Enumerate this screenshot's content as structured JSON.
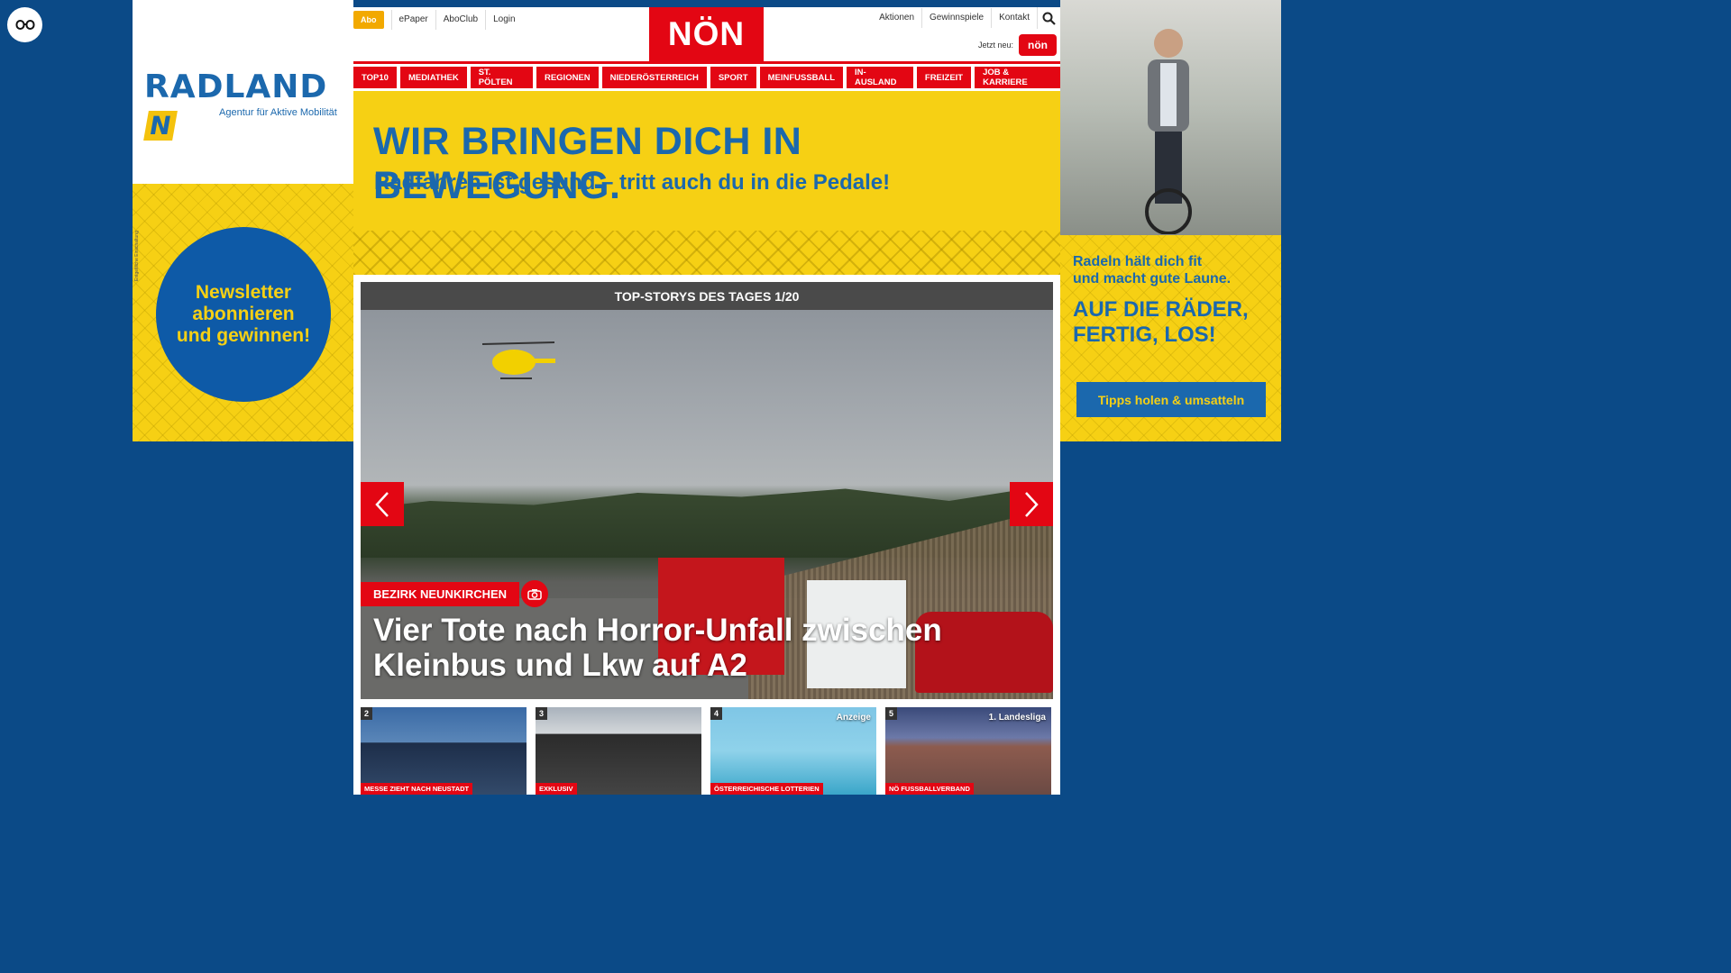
{
  "accessibility": {
    "icon": "glasses-icon"
  },
  "ad_left": {
    "brand": "RADLAND",
    "brand_badge": "N",
    "tagline": "Agentur für Aktive Mobilität",
    "newsletter_line1": "Newsletter",
    "newsletter_line2": "abonnieren",
    "newsletter_line3": "und gewinnen!",
    "small_print": "Entgeltliche Einschaltung"
  },
  "header": {
    "util_left": {
      "abo": "Abo",
      "epaper": "ePaper",
      "aboclub": "AboClub",
      "login": "Login"
    },
    "logo": "NÖN",
    "util_right": {
      "aktionen": "Aktionen",
      "gewinnspiele": "Gewinnspiele",
      "kontakt": "Kontakt"
    },
    "jetzt_neu": "Jetzt neu:",
    "badge": "nön"
  },
  "nav": {
    "items": [
      "TOP10",
      "MEDIATHEK",
      "ST. PÖLTEN",
      "REGIONEN",
      "NIEDERÖSTERREICH",
      "SPORT",
      "MEINFUSSBALL",
      "IN-AUSLAND",
      "FREIZEIT",
      "JOB & KARRIERE"
    ]
  },
  "banner": {
    "headline": "WIR BRINGEN DICH IN BEWEGUNG.",
    "subline": "Radfahren ist gesund – tritt auch du in die Pedale!"
  },
  "ad_right": {
    "text1_line1": "Radeln hält dich fit",
    "text1_line2": "und macht gute Laune.",
    "text2_line1": "AUF DIE RÄDER,",
    "text2_line2": "FERTIG, LOS!",
    "button": "Tipps holen & umsatteln"
  },
  "topstories": {
    "bar_title": "TOP-STORYS DES TAGES 1/20",
    "hero": {
      "tag": "BEZIRK NEUNKIRCHEN",
      "headline": "Vier Tote nach Horror-Unfall zwischen Kleinbus und Lkw auf A2"
    },
    "thumbs": [
      {
        "num": "2",
        "label": "MESSE ZIEHT NACH NEUSTADT",
        "corner": ""
      },
      {
        "num": "3",
        "label": "EXKLUSIV",
        "corner": ""
      },
      {
        "num": "4",
        "label": "ÖSTERREICHISCHE LOTTERIEN",
        "corner": "Anzeige"
      },
      {
        "num": "5",
        "label": "NÖ FUSSBALLVERBAND",
        "corner": "1. Landesliga"
      }
    ]
  },
  "colors": {
    "brand_red": "#e30613",
    "ad_yellow": "#f6d014",
    "ad_blue": "#1b68ad",
    "page_bg": "#0b4a87"
  }
}
